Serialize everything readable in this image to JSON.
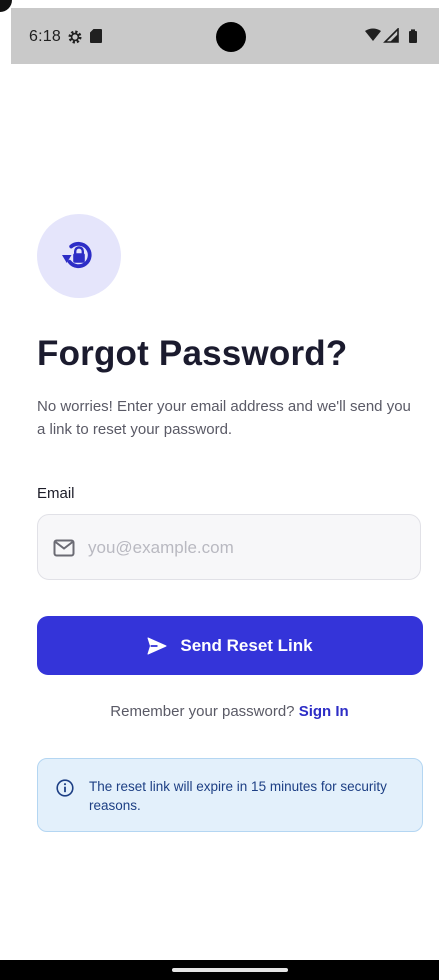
{
  "status_bar": {
    "time": "6:18",
    "left_icons": [
      "gear-icon",
      "sd-card-icon"
    ],
    "right_icons": [
      "wifi-icon",
      "signal-icon",
      "battery-icon"
    ]
  },
  "header": {
    "icon": "lock-reset-icon",
    "title": "Forgot Password?",
    "subtitle": "No worries! Enter your email address and we'll send you a link to reset your password."
  },
  "form": {
    "email_label": "Email",
    "email_value": "",
    "email_placeholder": "you@example.com",
    "email_icon": "mail-icon",
    "submit_label": "Send Reset Link",
    "submit_icon": "send-icon"
  },
  "signin": {
    "prompt": "Remember your password?",
    "link_label": "Sign In"
  },
  "info": {
    "icon": "info-icon",
    "text": "The reset link will expire in 15 minutes for security reasons."
  },
  "colors": {
    "primary": "#3434d9",
    "link": "#2d2dc6",
    "badge_background": "#e5e5fb",
    "info_background": "#e3f0fb",
    "info_border": "#b4d6f2",
    "info_text": "#1d3f84",
    "status_bar": "#c9c9c9"
  }
}
